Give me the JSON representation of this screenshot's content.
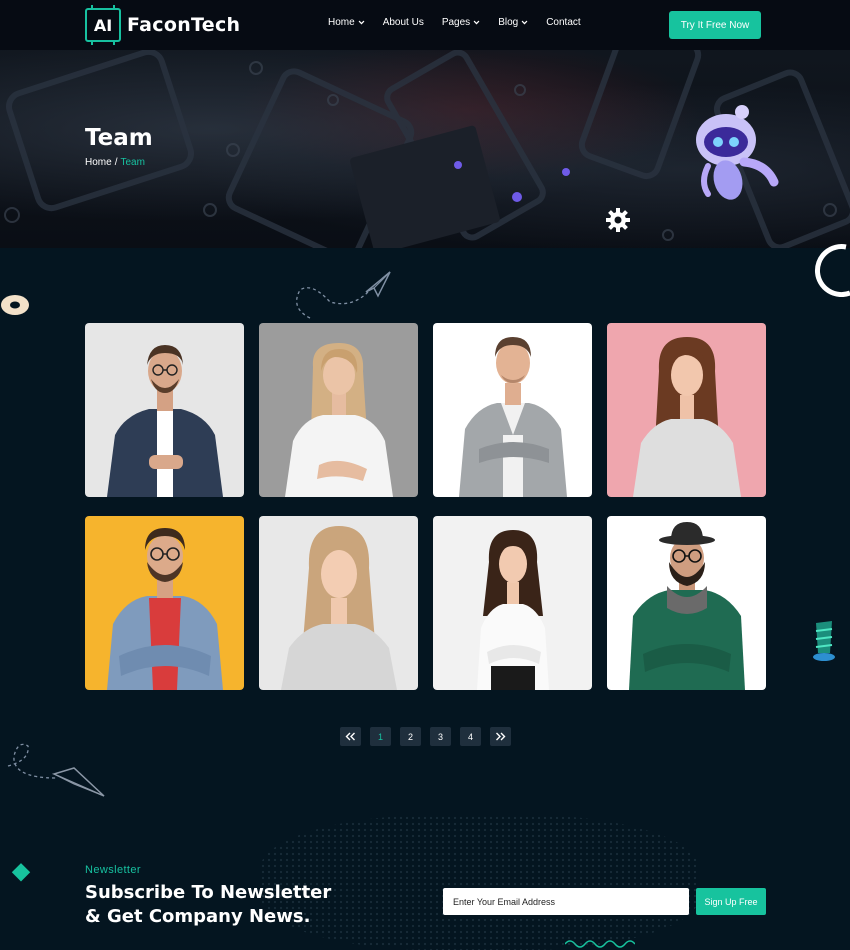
{
  "brand": {
    "logo_mark": "AI",
    "name": "FaconTech"
  },
  "nav": {
    "items": [
      {
        "label": "Home",
        "has_dropdown": true
      },
      {
        "label": "About Us",
        "has_dropdown": false
      },
      {
        "label": "Pages",
        "has_dropdown": true
      },
      {
        "label": "Blog",
        "has_dropdown": true
      },
      {
        "label": "Contact",
        "has_dropdown": false
      }
    ],
    "cta_label": "Try It Free Now"
  },
  "hero": {
    "title": "Team",
    "breadcrumb": {
      "home": "Home",
      "separator": "/",
      "current": "Team"
    }
  },
  "team": {
    "members": [
      {
        "photo_bg": "#e6e6e6",
        "figure": "man-denim-shirt-glasses"
      },
      {
        "photo_bg": "#9c9c9c",
        "figure": "woman-white-blouse-blonde"
      },
      {
        "photo_bg": "#ffffff",
        "figure": "man-grey-blazer"
      },
      {
        "photo_bg": "#efa6ae",
        "figure": "woman-grey-sweater-brunette"
      },
      {
        "photo_bg": "#f6b42d",
        "figure": "man-denim-jacket-beard-glasses"
      },
      {
        "photo_bg": "#e8e8e8",
        "figure": "woman-light-sweater-blonde"
      },
      {
        "photo_bg": "#f2f2f2",
        "figure": "woman-white-shirt-curly-hair"
      },
      {
        "photo_bg": "#ffffff",
        "figure": "man-green-sweater-hat-scarf"
      }
    ]
  },
  "pagination": {
    "prev_icon": "double-chevron-left-icon",
    "pages": [
      "1",
      "2",
      "3",
      "4"
    ],
    "active_page": "1",
    "next_icon": "double-chevron-right-icon"
  },
  "newsletter": {
    "kicker": "Newsletter",
    "title_line1": "Subscribe To Newsletter",
    "title_line2": "& Get Company News.",
    "email_placeholder": "Enter Your Email Address",
    "button_label": "Sign Up Free"
  },
  "colors": {
    "accent": "#17c39e",
    "background": "#041520",
    "header_bg": "#060b13",
    "pagination_bg": "#1f2f3d"
  }
}
